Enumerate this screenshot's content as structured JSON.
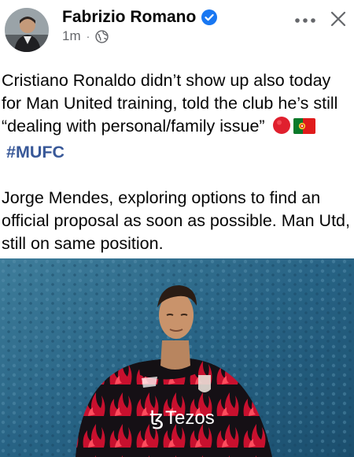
{
  "post": {
    "author": "Fabrizio Romano",
    "time": "1m",
    "separator": "·",
    "body_line1": "Cristiano Ronaldo didn’t show up also today for Man United training, told the club he’s still “dealing with personal/family issue”",
    "hashtag": "#MUFC",
    "body_line2": "Jorge Mendes, exploring options to find an official proposal as soon as possible. Man Utd, still on same position.",
    "photo_logo_text": "Tezos",
    "photo_logo_symbol": "ꜩ"
  },
  "icons": {
    "verified": "verified-badge-icon",
    "audience": "globe-icon",
    "more": "more-options-icon",
    "close": "close-icon",
    "emoji_1": "red-circle",
    "emoji_2": "portugal-flag"
  },
  "colors": {
    "verified_blue": "#1877f2",
    "hashtag_blue": "#385898",
    "secondary_text": "#65676b",
    "shirt_red": "#c8102e"
  }
}
